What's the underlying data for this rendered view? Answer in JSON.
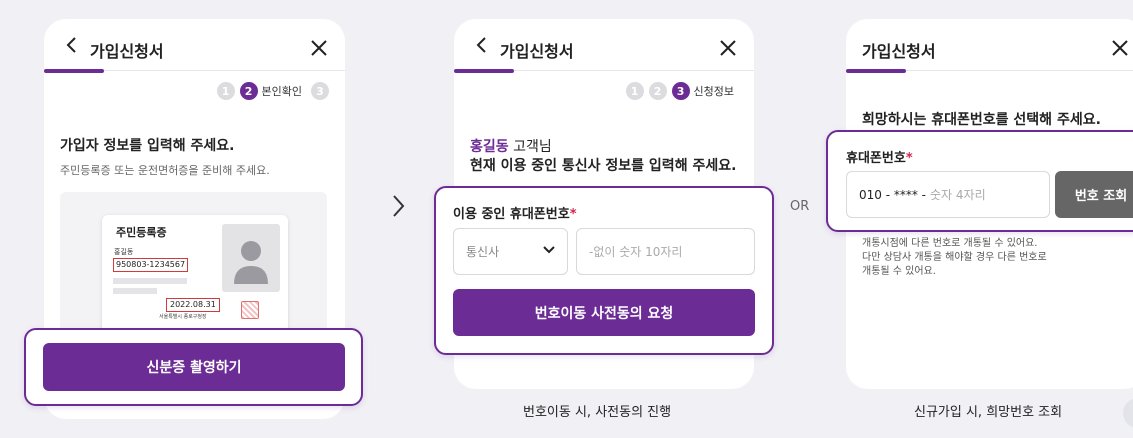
{
  "colors": {
    "accent": "#6c2c95",
    "required": "#d0284a",
    "gray_button": "#666666",
    "background": "#f1f0f5"
  },
  "separator": {
    "arrow_icon": "chevron-right-icon",
    "or_label": "OR"
  },
  "screen1": {
    "title": "가입신청서",
    "back_icon": "chevron-left-icon",
    "close_icon": "close-icon",
    "steps": [
      {
        "number": "1",
        "active": false
      },
      {
        "number": "2",
        "active": true,
        "label": "본인확인"
      },
      {
        "number": "3",
        "active": false
      }
    ],
    "heading": "가입자 정보를 입력해 주세요.",
    "subtext": "주민등록증 또는 운전면허증을 준비해 주세요.",
    "id_card": {
      "title": "주민등록증",
      "name": "홍길동",
      "number": "950803-1234567",
      "issue_date": "2022.08.31",
      "issuer": "서울특별시 종로구청장"
    },
    "capture_button": "신분증 촬영하기"
  },
  "screen2": {
    "title": "가입신청서",
    "back_icon": "chevron-left-icon",
    "close_icon": "close-icon",
    "steps": [
      {
        "number": "1",
        "active": false
      },
      {
        "number": "2",
        "active": false
      },
      {
        "number": "3",
        "active": true,
        "label": "신청정보"
      }
    ],
    "customer_name": "홍길동",
    "customer_suffix": " 고객님",
    "heading": "현재 이용 중인 통신사 정보를 입력해 주세요.",
    "field_label": "이용 중인 휴대폰번호",
    "required_mark": "*",
    "carrier_placeholder": "통신사",
    "phone_placeholder": "-없이 숫자 10자리",
    "submit_button": "번호이동 사전동의 요청",
    "caption": "번호이동 시, 사전동의 진행"
  },
  "screen3": {
    "title": "가입신청서",
    "close_icon": "close-icon",
    "heading": "희망하시는 휴대폰번호를 선택해 주세요.",
    "field_label": "휴대폰번호",
    "required_mark": "*",
    "phone_prefix": "010 - **** - ",
    "phone_placeholder": "숫자 4자리",
    "lookup_button": "번호 조회",
    "notice_lines": [
      "개통시점에 다른 번호로 개통될 수 있어요.",
      "다만 상담사 개통을 해야할 경우 다른 번호로",
      "개통될 수 있어요."
    ],
    "caption": "신규가입 시, 희망번호 조회"
  }
}
